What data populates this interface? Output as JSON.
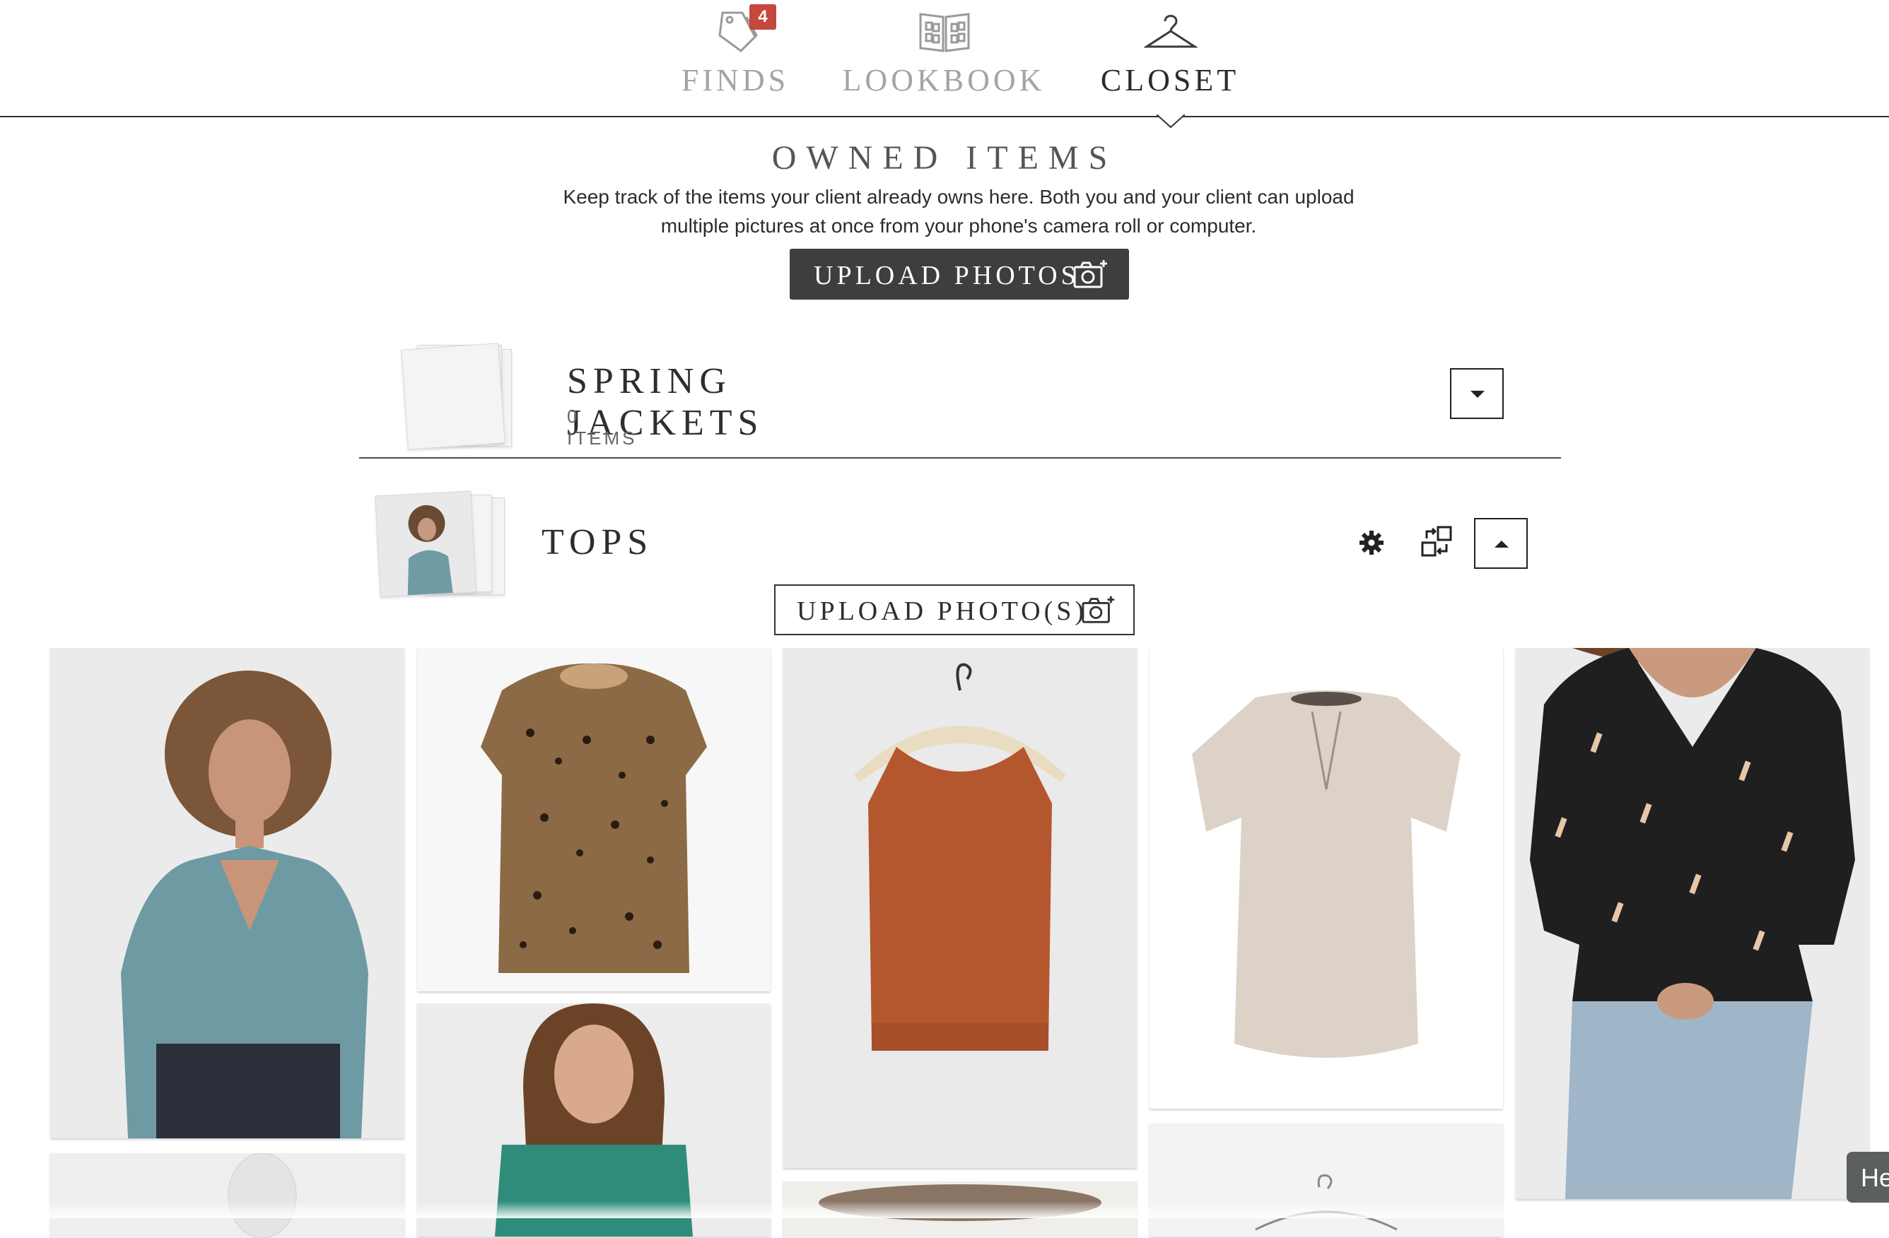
{
  "nav": {
    "tabs": [
      {
        "label": "FINDS",
        "icon": "price-tags-icon",
        "badge": "4"
      },
      {
        "label": "LOOKBOOK",
        "icon": "lookbook-icon"
      },
      {
        "label": "CLOSET",
        "icon": "hanger-icon",
        "active": true
      }
    ]
  },
  "owned": {
    "title": "OWNED ITEMS",
    "description": "Keep track of the items your client already owns here. Both you and your client can upload multiple pictures at once from your phone's camera roll or computer.",
    "upload_label": "UPLOAD PHOTOS"
  },
  "collections": [
    {
      "name": "SPRING JACKETS",
      "count": "0",
      "count_unit": "ITEMS",
      "expanded": false
    },
    {
      "name": "TOPS",
      "expanded": true,
      "upload_label": "UPLOAD PHOTO(S)"
    }
  ],
  "products": [
    {
      "name": "Floral v-neck blouse on model",
      "color": "#5e8c8e"
    },
    {
      "name": "Leopard print ruffle top",
      "color": "#8b6a45"
    },
    {
      "name": "Rust sleeveless tank on hanger",
      "color": "#b4572f"
    },
    {
      "name": "Speckled cap sleeve blouse",
      "color": "#ddd2c7"
    },
    {
      "name": "Black print wrap blouse",
      "color": "#1f1f1f"
    },
    {
      "name": "Teal square neck top",
      "color": "#2f8c7a"
    }
  ],
  "help": {
    "label": "He"
  },
  "colors": {
    "accent_badge": "#c5473d",
    "dark_button": "#3d3e3e"
  }
}
